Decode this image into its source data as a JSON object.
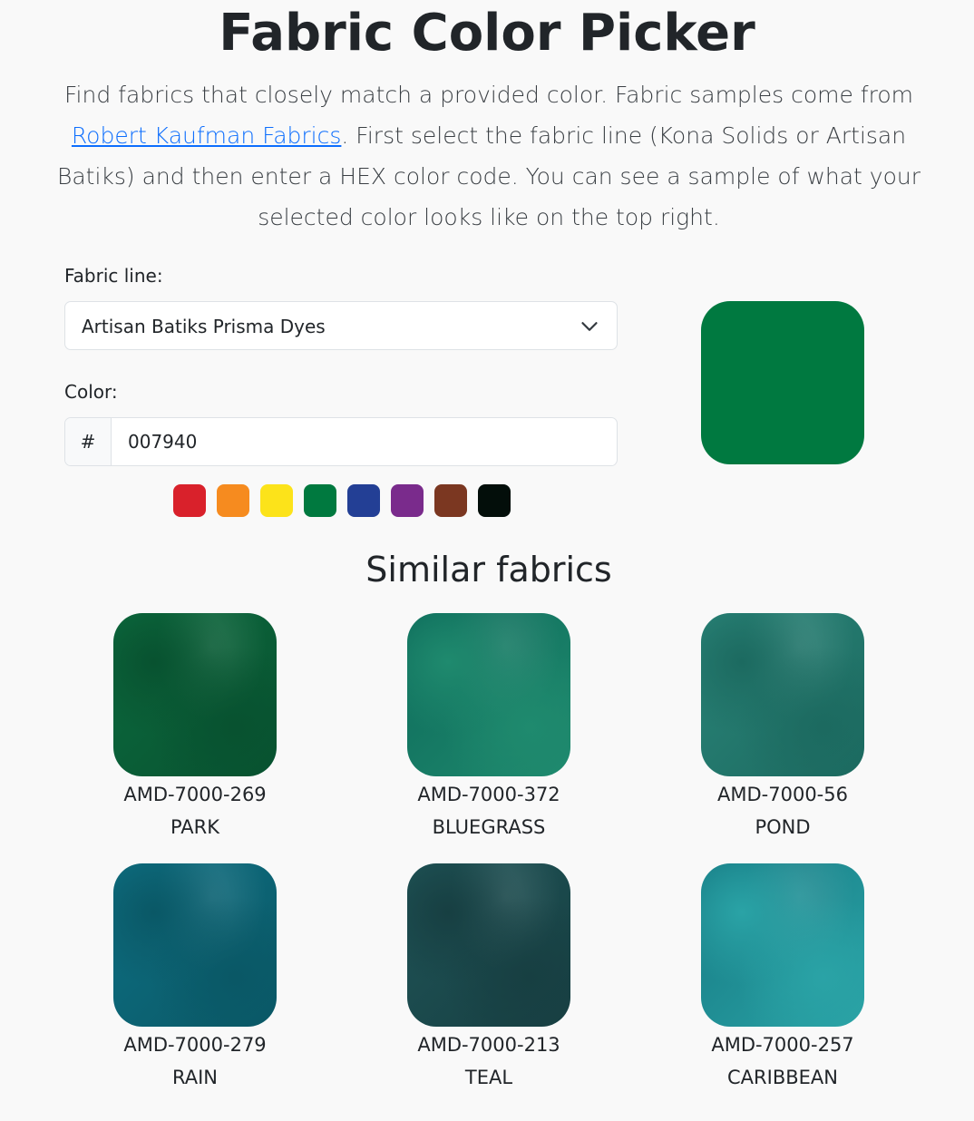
{
  "page": {
    "title": "Fabric Color Picker",
    "intro_before_link": "Find fabrics that closely match a provided color. Fabric samples come from ",
    "intro_link": "Robert Kaufman Fabrics",
    "intro_after_link": ". First select the fabric line (Kona Solids or Artisan Batiks) and then enter a HEX color code. You can see a sample of what your selected color looks like on the top right."
  },
  "form": {
    "fabric_line_label": "Fabric line:",
    "fabric_line_value": "Artisan Batiks Prisma Dyes",
    "color_label": "Color:",
    "hex_prefix": "#",
    "hex_value": "007940",
    "preview_color": "#007940"
  },
  "swatches": [
    {
      "name": "red",
      "color": "#d9212b"
    },
    {
      "name": "orange",
      "color": "#f68b1f"
    },
    {
      "name": "yellow",
      "color": "#fce31a"
    },
    {
      "name": "green",
      "color": "#00793f"
    },
    {
      "name": "blue",
      "color": "#233f95"
    },
    {
      "name": "purple",
      "color": "#7a2b8c"
    },
    {
      "name": "brown",
      "color": "#7b3721"
    },
    {
      "name": "black",
      "color": "#030e0a"
    }
  ],
  "results": {
    "title": "Similar fabrics",
    "fabrics": [
      {
        "code": "AMD-7000-269",
        "name": "PARK",
        "color": "#0c6a3e",
        "accent": "#085230"
      },
      {
        "code": "AMD-7000-372",
        "name": "BLUEGRASS",
        "color": "#0d6a5a",
        "accent": "#1f8a6e"
      },
      {
        "code": "AMD-7000-56",
        "name": "POND",
        "color": "#2a8478",
        "accent": "#1c6a60"
      },
      {
        "code": "AMD-7000-279",
        "name": "RAIN",
        "color": "#0e6f82",
        "accent": "#0a5866"
      },
      {
        "code": "AMD-7000-213",
        "name": "TEAL",
        "color": "#1f5457",
        "accent": "#173f42"
      },
      {
        "code": "AMD-7000-257",
        "name": "CARIBBEAN",
        "color": "#167a83",
        "accent": "#2aa3a6"
      }
    ]
  }
}
